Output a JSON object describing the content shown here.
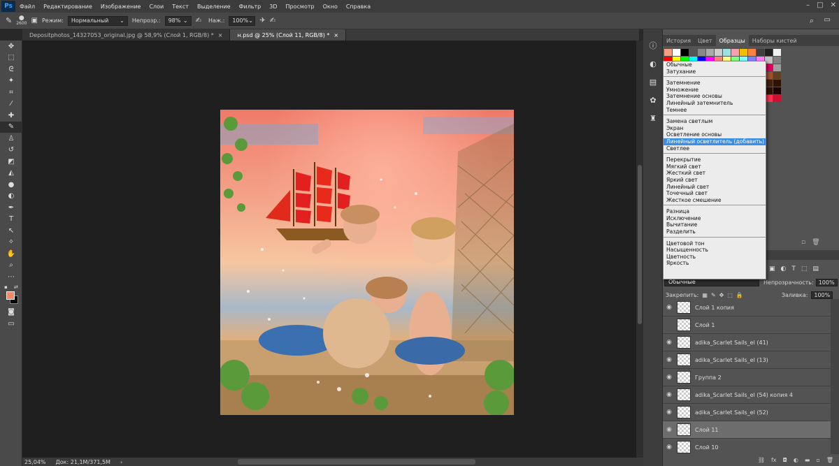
{
  "menubar": {
    "logo": "Ps",
    "items": [
      "Файл",
      "Редактирование",
      "Изображение",
      "Слои",
      "Текст",
      "Выделение",
      "Фильтр",
      "3D",
      "Просмотр",
      "Окно",
      "Справка"
    ]
  },
  "options": {
    "brush_size": "2600",
    "mode_label": "Режим:",
    "mode_value": "Нормальный",
    "opacity_label": "Непрозр.:",
    "opacity_value": "98%",
    "flow_label": "Наж.:",
    "flow_value": "100%"
  },
  "tabs": [
    {
      "label": "Depositphotos_14327053_original.jpg @ 58,9% (Слой 1, RGB/8) *",
      "active": false
    },
    {
      "label": "н.psd @ 25% (Слой 11, RGB/8) *",
      "active": true
    }
  ],
  "status": {
    "zoom": "25,04%",
    "doc": "Док: 21,1M/371,5M"
  },
  "panel_tabs": [
    "История",
    "Цвет",
    "Образцы",
    "Наборы кистей"
  ],
  "swatch_colors": [
    "#f4a080",
    "#ffffff",
    "#000000",
    "#555555",
    "#888888",
    "#aaaaaa",
    "#cccccc",
    "#9fe0e0",
    "#f4a0b0",
    "#f0c000",
    "#ff8040",
    "#404040",
    "#202020",
    "#f0f0f0",
    "#ff0000",
    "#ffff00",
    "#00ff00",
    "#00ffff",
    "#0000ff",
    "#ff00ff",
    "#ff8080",
    "#ffff80",
    "#80ff80",
    "#80ffff",
    "#8080ff",
    "#ff80ff",
    "#c0c0c0",
    "#808080",
    "#ff4040",
    "#ffc040",
    "#c0ff40",
    "#40ffc0",
    "#40c0ff",
    "#c040ff",
    "#ff40c0",
    "#ff6000",
    "#e0e000",
    "#00e060",
    "#00a0e0",
    "#6000e0",
    "#e00060",
    "#a0a0a0",
    "#c00000",
    "#c0c000",
    "#00c000",
    "#00c0c0",
    "#0000c0",
    "#c000c0",
    "#c06040",
    "#a08040",
    "#608040",
    "#406080",
    "#604080",
    "#804060",
    "#a05030",
    "#604020",
    "#800000",
    "#808000",
    "#008000",
    "#008080",
    "#000080",
    "#800080",
    "#b08060",
    "#907050",
    "#706040",
    "#505030",
    "#8a5030",
    "#603020",
    "#402010",
    "#301000",
    "#f0d0b0",
    "#e0c0a0",
    "#d0b090",
    "#c0a080",
    "#b09070",
    "#a08060",
    "#907050",
    "#806040",
    "#705030",
    "#604020",
    "#503010",
    "#402000",
    "#301000",
    "#200000",
    "#ff8080",
    "#ff4040",
    "#ff0000",
    "#e00000",
    "#c00000",
    "#a00000",
    "#ff6060",
    "#ff2020",
    "#e02020",
    "#c02020",
    "#ff0040",
    "#e00030",
    "#ff3050",
    "#d01030"
  ],
  "blend_menu": {
    "groups": [
      [
        "Обычные",
        "Затухание"
      ],
      [
        "Затемнение",
        "Умножение",
        "Затемнение основы",
        "Линейный затемнитель",
        "Темнее"
      ],
      [
        "Замена светлым",
        "Экран",
        "Осветление основы",
        "Линейный осветлитель (добавить)",
        "Светлее"
      ],
      [
        "Перекрытие",
        "Мягкий свет",
        "Жесткий свет",
        "Яркий свет",
        "Линейный свет",
        "Точечный свет",
        "Жесткое смешение"
      ],
      [
        "Разница",
        "Исключение",
        "Вычитание",
        "Разделить"
      ],
      [
        "Цветовой тон",
        "Насыщенность",
        "Цветность",
        "Яркость"
      ]
    ],
    "highlighted": "Линейный осветлитель (добавить)"
  },
  "layers_panel": {
    "blend_value": "Обычные",
    "opacity_label": "Непрозрачность:",
    "opacity_value": "100%",
    "lock_label": "Закрепить:",
    "fill_label": "Заливка:",
    "fill_value": "100%",
    "layers": [
      {
        "name": "Слой 1 копия",
        "visible": true,
        "active": false
      },
      {
        "name": "Слой 1",
        "visible": false,
        "active": false
      },
      {
        "name": "adika_Scarlet Sails_el (41)",
        "visible": true,
        "active": false
      },
      {
        "name": "adika_Scarlet Sails_el (13)",
        "visible": true,
        "active": false
      },
      {
        "name": "Группа 2",
        "visible": true,
        "active": false
      },
      {
        "name": "adika_Scarlet Sails_el (54) копия 4",
        "visible": true,
        "active": false
      },
      {
        "name": "adika_Scarlet Sails_el (52)",
        "visible": true,
        "active": false
      },
      {
        "name": "Слой 11",
        "visible": true,
        "active": true
      },
      {
        "name": "Слой 10",
        "visible": true,
        "active": false
      }
    ]
  },
  "colors": {
    "foreground": "#f08a6a",
    "background": "#000000",
    "accent": "#3a8ee6"
  }
}
